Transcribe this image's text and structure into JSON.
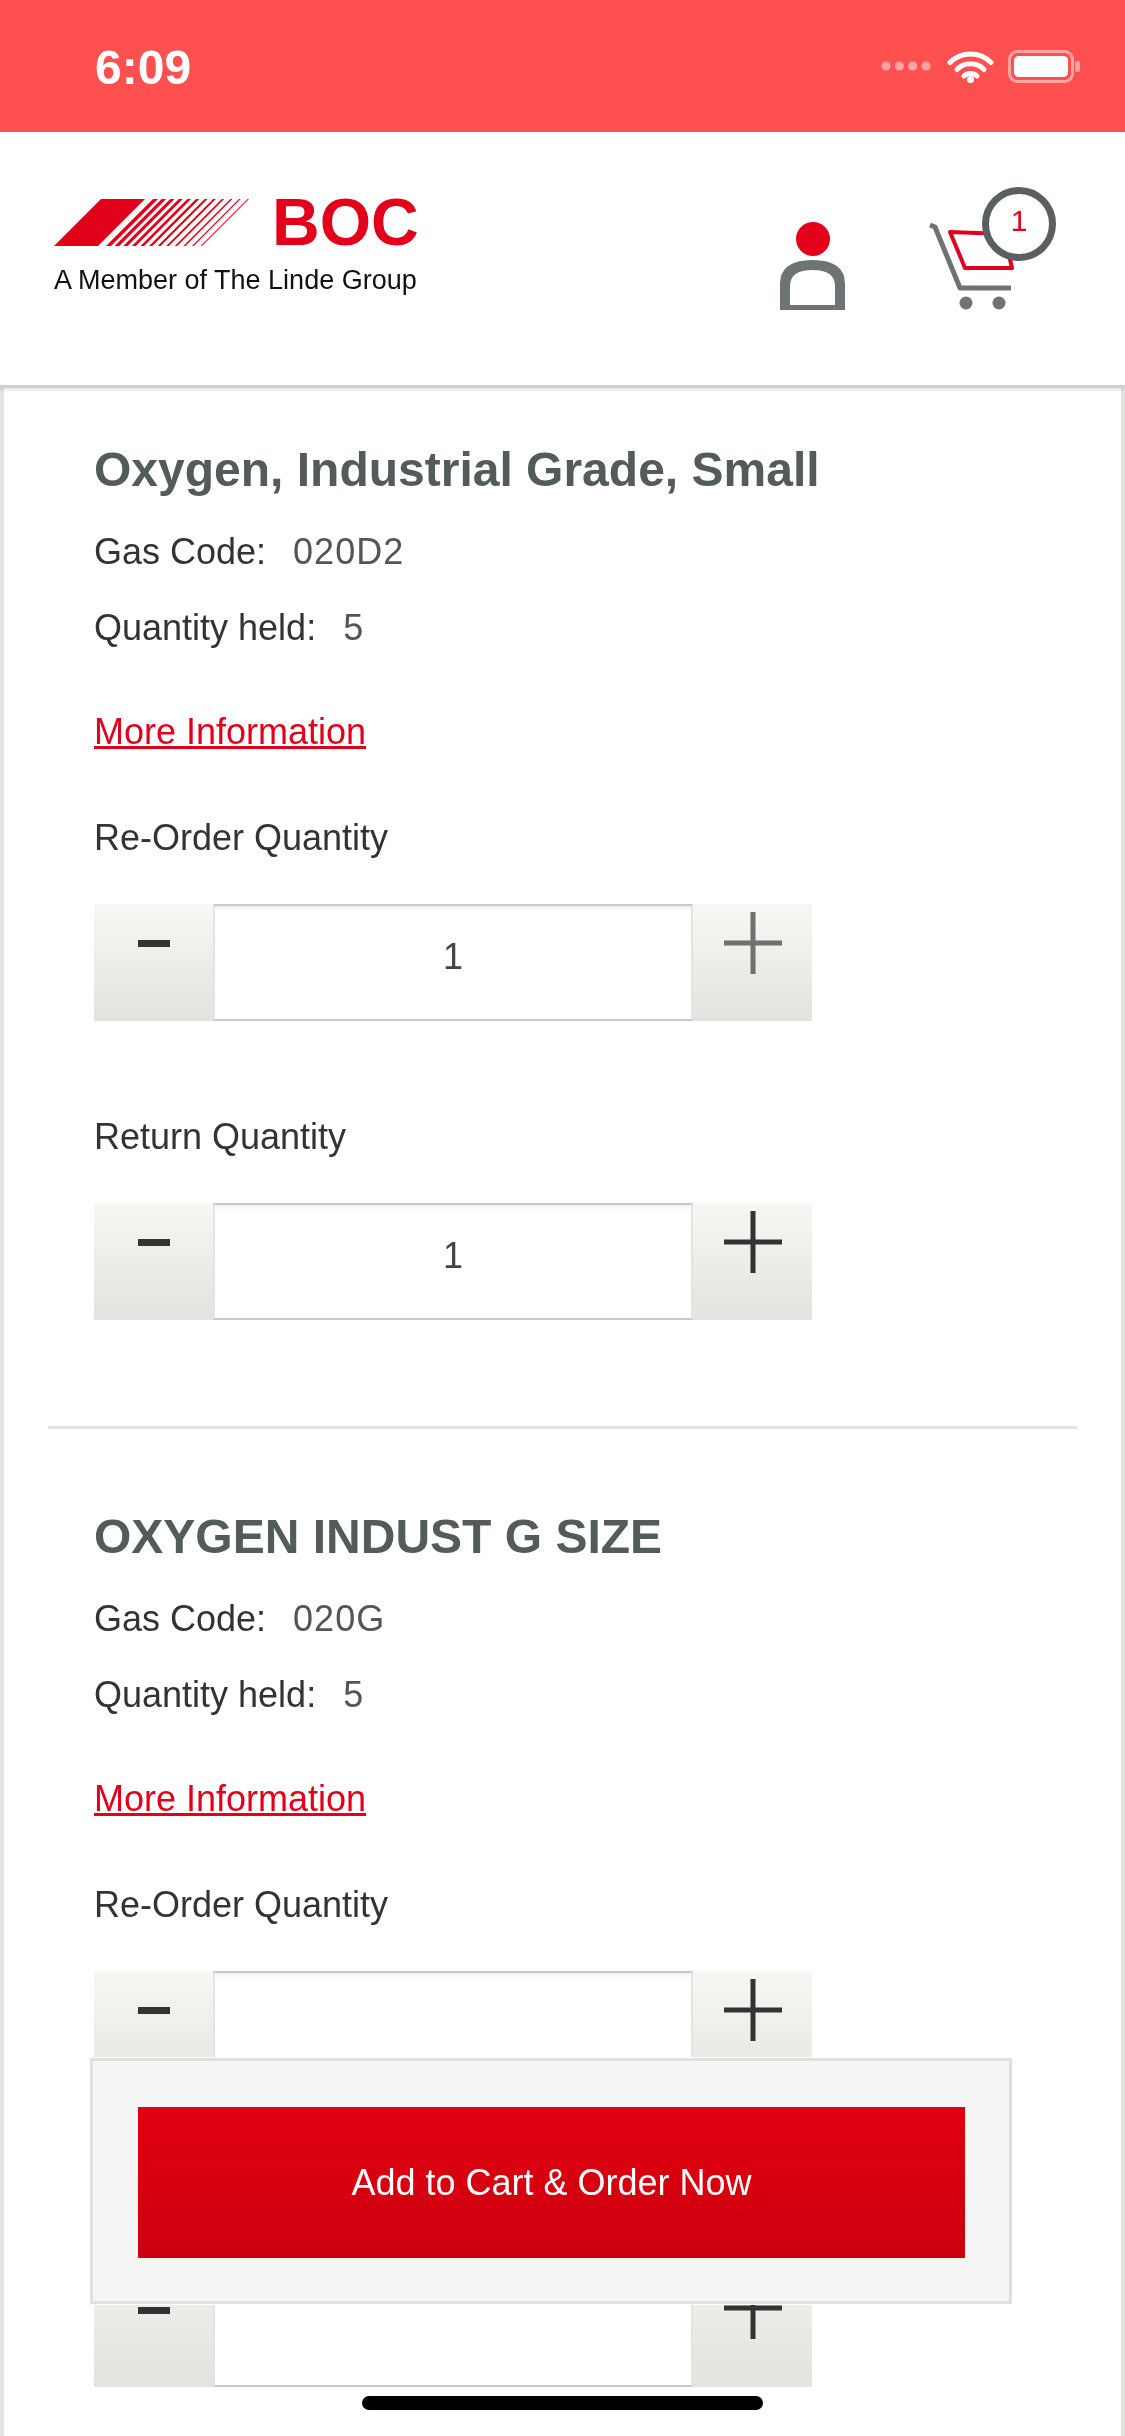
{
  "status_bar": {
    "time": "6:09"
  },
  "header": {
    "logo": {
      "wordmark": "BOC",
      "tagline": "A Member of The Linde Group"
    },
    "cart_badge": "1"
  },
  "products": [
    {
      "title": "Oxygen, Industrial Grade, Small",
      "details": [
        {
          "label": "Gas Code:",
          "value": "020D2"
        },
        {
          "label": "Quantity held:",
          "value": "5"
        }
      ],
      "link": "More Information",
      "steppers": [
        {
          "label": "Re-Order Quantity",
          "value": "1",
          "increase_disabled": true
        },
        {
          "label": "Return Quantity",
          "value": "1",
          "increase_disabled": false
        }
      ]
    },
    {
      "title": "OXYGEN INDUST G SIZE",
      "details": [
        {
          "label": "Gas Code:",
          "value": "020G"
        },
        {
          "label": "Quantity held:",
          "value": "5"
        }
      ],
      "link": "More Information",
      "steppers": [
        {
          "label": "Re-Order Quantity",
          "increase_disabled": false
        },
        {
          "increase_disabled": false
        }
      ]
    }
  ],
  "action_panel": {
    "button": "Add to Cart & Order Now"
  }
}
